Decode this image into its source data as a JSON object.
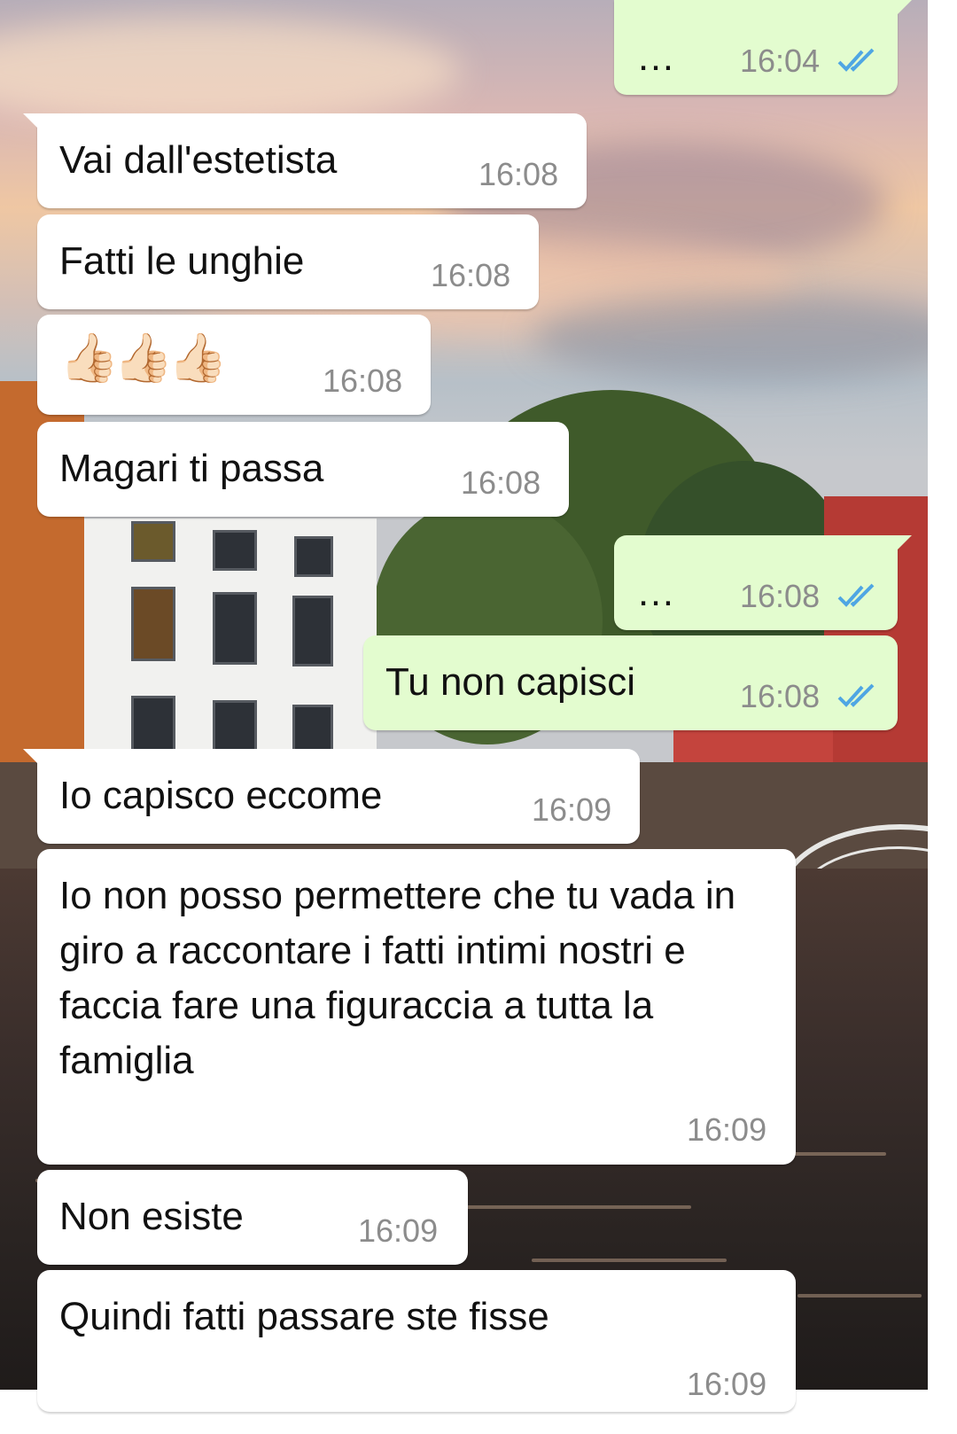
{
  "messages": [
    {
      "side": "out",
      "text": "…",
      "time": "16:04",
      "status": "read"
    },
    {
      "side": "in",
      "text": "Vai dall'estetista",
      "time": "16:08"
    },
    {
      "side": "in",
      "text": "Fatti le unghie",
      "time": "16:08"
    },
    {
      "side": "in",
      "text": "👍🏻👍🏻👍🏻",
      "time": "16:08"
    },
    {
      "side": "in",
      "text": "Magari ti passa",
      "time": "16:08"
    },
    {
      "side": "out",
      "text": "…",
      "time": "16:08",
      "status": "read"
    },
    {
      "side": "out",
      "text": "Tu non capisci",
      "time": "16:08",
      "status": "read"
    },
    {
      "side": "in",
      "text": "Io capisco eccome",
      "time": "16:09"
    },
    {
      "side": "in",
      "text": "Io non posso permettere che tu vada in giro a raccontare i fatti intimi nostri e faccia fare una figuraccia a tutta la famiglia",
      "time": "16:09"
    },
    {
      "side": "in",
      "text": "Non esiste",
      "time": "16:09"
    },
    {
      "side": "in",
      "text": "Quindi fatti passare ste fisse",
      "time": "16:09"
    }
  ],
  "colors": {
    "incoming": "#ffffff",
    "outgoing": "#e3fccf",
    "timestamp": "#8c8c8c",
    "read_ticks": "#4fa6e3"
  }
}
